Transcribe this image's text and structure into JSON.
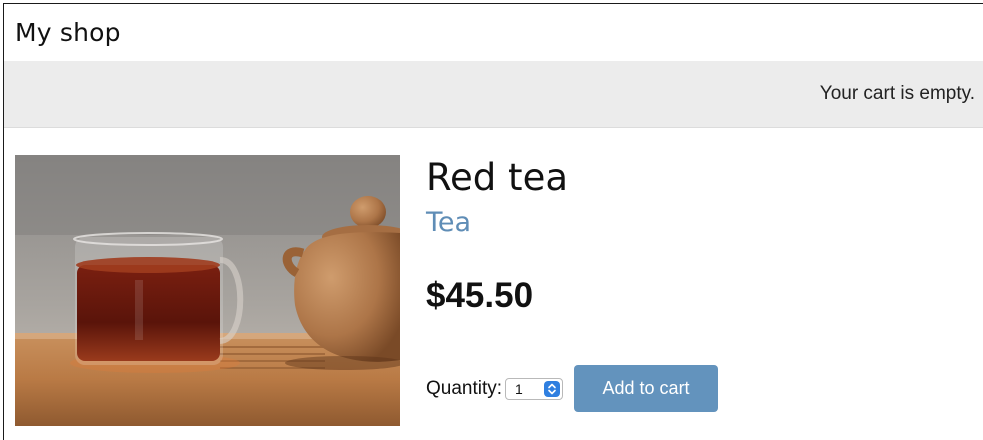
{
  "header": {
    "title": "My shop"
  },
  "cart": {
    "status": "Your cart is empty."
  },
  "product": {
    "image_name": "red-tea-photo",
    "name": "Red tea",
    "category": "Tea",
    "price": "$45.50",
    "quantity_label": "Quantity:",
    "quantity_value": "1",
    "add_button_label": "Add to cart"
  },
  "colors": {
    "category_link": "#5f8db6",
    "add_button": "#6393bd",
    "cart_bar": "#ececec"
  },
  "icons": {
    "stepper": "up-down-chevron-icon"
  }
}
